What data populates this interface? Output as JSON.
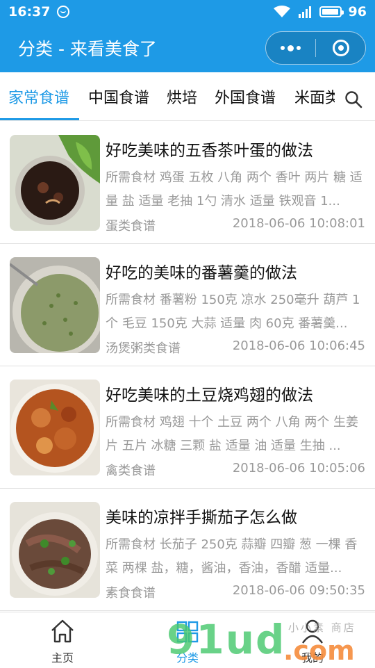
{
  "status_bar": {
    "time": "16:37",
    "battery": "96",
    "battery_level": 0.96,
    "network": "4G"
  },
  "navbar": {
    "title": "分类 - 来看美食了"
  },
  "tabs": [
    {
      "label": "家常食谱",
      "active": true
    },
    {
      "label": "中国食谱",
      "active": false
    },
    {
      "label": "烘培",
      "active": false
    },
    {
      "label": "外国食谱",
      "active": false
    },
    {
      "label": "米面类",
      "active": false
    }
  ],
  "recipes": [
    {
      "name": "好吃美味的五香茶叶蛋的做法",
      "desc": "所需食材 鸡蛋 五枚 八角 两个 香叶 两片 糖 适量 盐 适量 老抽 1勺 清水 适量 铁观音 1...",
      "category": "蛋类食谱",
      "date": "2018-06-06 10:08:01"
    },
    {
      "name": "好吃的美味的番薯羹的做法",
      "desc": "所需食材 番薯粉 150克 凉水 250毫升 葫芦 1个 毛豆 150克 大蒜 适量 肉 60克 番薯羹...",
      "category": "汤煲粥类食谱",
      "date": "2018-06-06 10:06:45"
    },
    {
      "name": "好吃美味的土豆烧鸡翅的做法",
      "desc": "所需食材 鸡翅 十个 土豆 两个 八角 两个 生姜片 五片 冰糖 三颗 盐 适量 油 适量 生抽 ...",
      "category": "禽类食谱",
      "date": "2018-06-06 10:05:06"
    },
    {
      "name": "美味的凉拌手撕茄子怎么做",
      "desc": "所需食材 长茄子 250克 蒜瓣 四瓣 葱 一棵 香菜 两棵 盐，糖，酱油，香油，香醋 适量...",
      "category": "素食食谱",
      "date": "2018-06-06 09:50:35"
    }
  ],
  "tabbar": [
    {
      "label": "主页",
      "icon": "home-icon"
    },
    {
      "label": "分类",
      "icon": "grid-icon"
    },
    {
      "label": "我的",
      "icon": "user-icon"
    }
  ],
  "watermark": {
    "text": "91ud",
    "domain": ".com",
    "small": "小小素 商店"
  },
  "colors": {
    "accent": "#1e9ae6",
    "text_muted": "#999999"
  }
}
